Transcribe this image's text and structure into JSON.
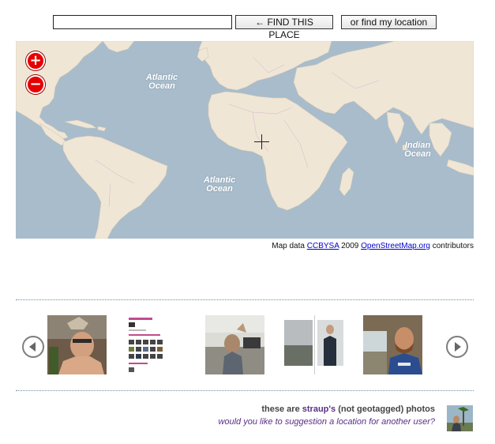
{
  "search": {
    "value": "",
    "find_place_label": "← FIND THIS PLACE",
    "find_location_label": "or find my location"
  },
  "map": {
    "zoom_in": "+",
    "zoom_out": "−",
    "ocean_labels": {
      "north_atlantic_1": "Atlantic",
      "north_atlantic_2": "Ocean",
      "south_atlantic_1": "Atlantic",
      "south_atlantic_2": "Ocean",
      "indian_1": "Indian",
      "indian_2": "Ocean"
    },
    "colors": {
      "water": "#a8bccb",
      "land": "#f0e6d6"
    }
  },
  "attribution": {
    "prefix": "Map data",
    "license": "CCBYSA",
    "year": "2009",
    "source": "OpenStreetMap.org",
    "suffix": "contributors"
  },
  "carousel": {
    "prev_icon": "left-arrow-icon",
    "next_icon": "right-arrow-icon"
  },
  "caption": {
    "pre": "these are",
    "user": "straup's",
    "post": "(not geotagged) photos",
    "question": "would you like to suggestion a location for another user?"
  }
}
